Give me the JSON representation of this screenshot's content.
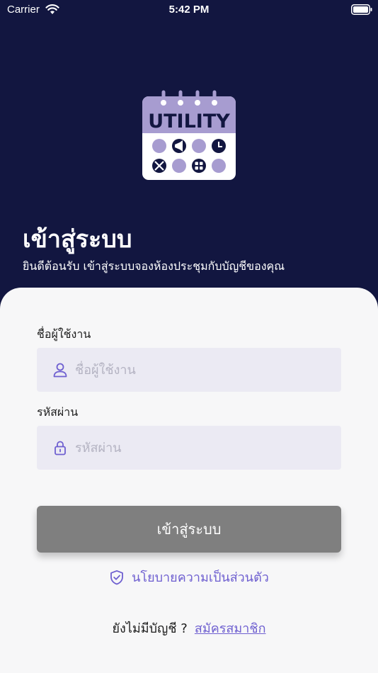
{
  "status_bar": {
    "carrier": "Carrier",
    "time": "5:42 PM"
  },
  "logo": {
    "text": "UTILITY",
    "colors": {
      "calendar": "#a79cd0",
      "card": "#ffffff",
      "ink": "#121640"
    }
  },
  "header": {
    "title": "เข้าสู่ระบบ",
    "subtitle": "ยินดีต้อนรับ เข้าสู่ระบบจองห้องประชุมกับบัญชีของคุณ"
  },
  "form": {
    "username": {
      "label": "ชื่อผู้ใช้งาน",
      "placeholder": "ชื่อผู้ใช้งาน",
      "value": "",
      "icon": "user-icon"
    },
    "password": {
      "label": "รหัสผ่าน",
      "placeholder": "รหัสผ่าน",
      "value": "",
      "icon": "lock-icon"
    },
    "submit_label": "เข้าสู่ระบบ"
  },
  "privacy": {
    "label": "นโยบายความเป็นส่วนตัว",
    "icon": "shield-check-icon"
  },
  "signup": {
    "question": "ยังไม่มีบัญชี ?",
    "link_label": "สมัครสมาชิก"
  },
  "colors": {
    "background": "#121640",
    "accent": "#6e5fd0",
    "button": "#7f7f7f",
    "input_bg": "#ebeaf3"
  }
}
